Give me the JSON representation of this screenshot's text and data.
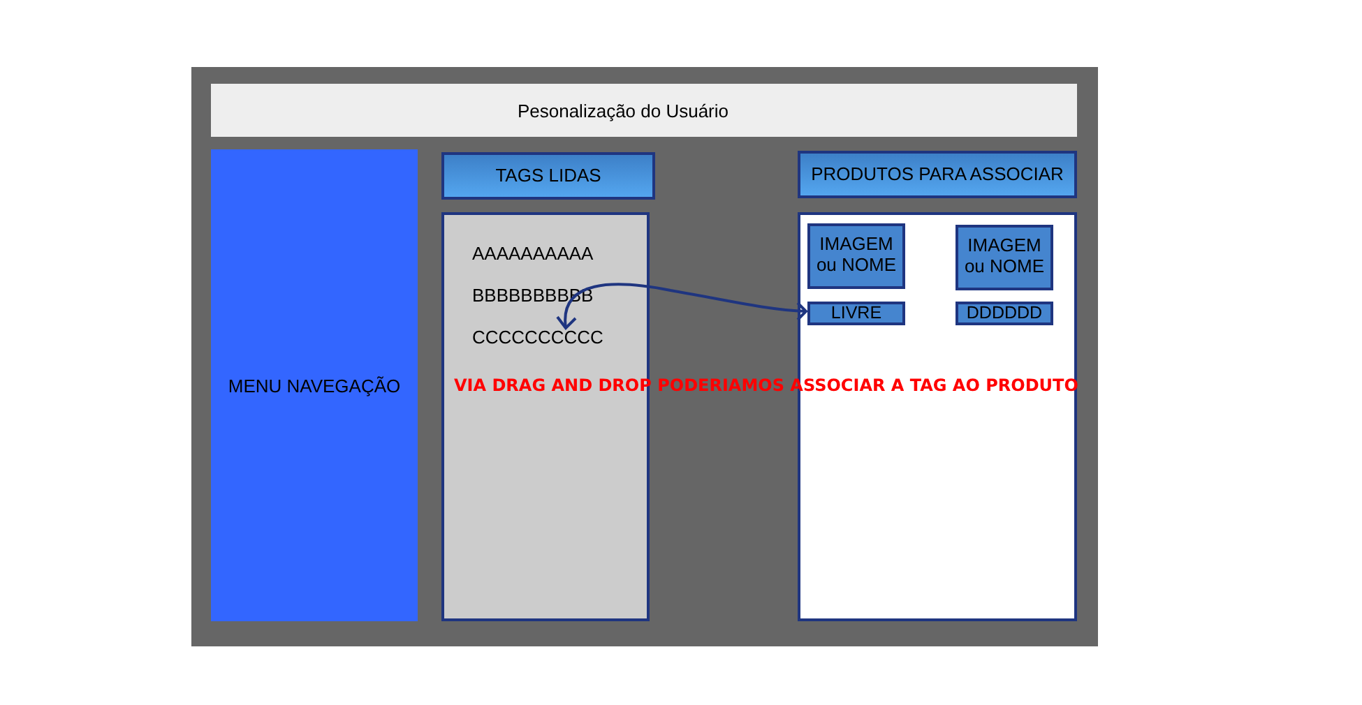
{
  "title": "Pesonalização do Usuário",
  "menu": {
    "label": "MENU NAVEGAÇÃO"
  },
  "tags_panel": {
    "header": "TAGS LIDAS",
    "tags": [
      "AAAAAAAAAA",
      "BBBBBBBBBB",
      "CCCCCCCCCC"
    ]
  },
  "products_panel": {
    "header": "PRODUTOS PARA ASSOCIAR",
    "products": [
      {
        "image_label": "IMAGEM ou NOME",
        "tag": "LIVRE"
      },
      {
        "image_label": "IMAGEM ou NOME",
        "tag": "DDDDDD"
      }
    ]
  },
  "annotation": "VIA DRAG AND DROP PODERIAMOS ASSOCIAR A TAG AO PRODUTO"
}
